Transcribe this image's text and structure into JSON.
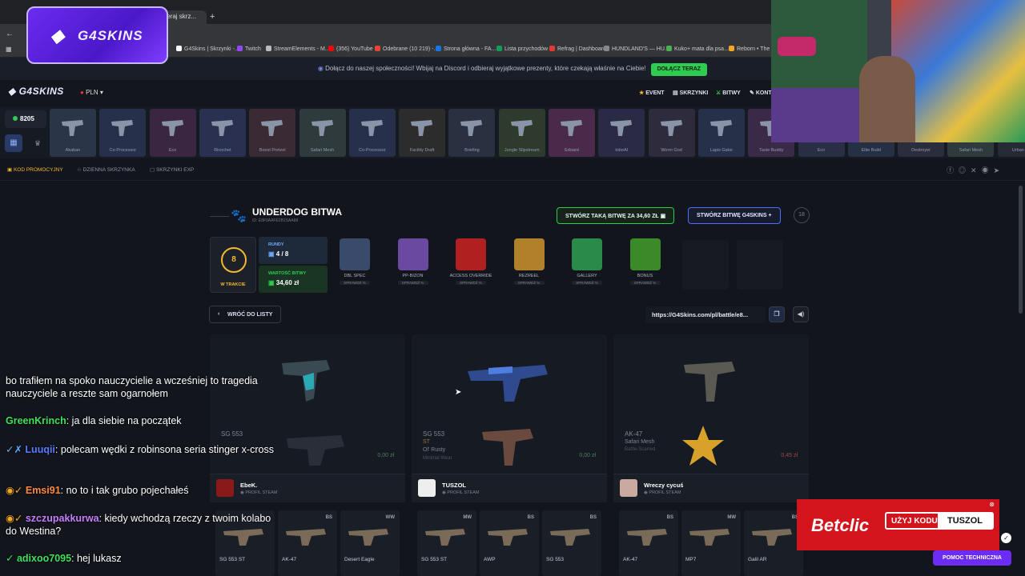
{
  "browser": {
    "active_tab": "dieraj skrz...",
    "bookmarks": [
      "G4Skins | Skrzynki -...",
      "Twitch",
      "StreamElements - M...",
      "(356) YouTube",
      "Odebrane (10 219) -...",
      "Strona główna - FA...",
      "Lista przychodów",
      "Refrag | Dashboard",
      "HUNDLAND'S — HU...",
      "Kuko+ mata dla psa...",
      "Reborn • The H"
    ]
  },
  "banner": {
    "text": "Dołącz do naszej społeczności! Wbijaj na Discord i odbieraj wyjątkowe prezenty, które czekają właśnie na Ciebie!",
    "button": "DOŁĄCZ TERAZ"
  },
  "header": {
    "logo": "G4SKINS",
    "currency": "PLN",
    "nav": [
      "EVENT",
      "SKRZYNKI",
      "BITWY",
      "KONT"
    ]
  },
  "strip": {
    "balance": "8205",
    "cases": [
      "Akaban",
      "Co-Processor",
      "Eco",
      "Ricochet",
      "Boost Pretzel",
      "Safari Mesh",
      "Co-Processor",
      "Facility Draft",
      "Briefing",
      "Jungle Slipstream",
      "Edoard",
      "tobeAI",
      "Worm God",
      "Lapis Gator",
      "Taste Buddy",
      "Eco",
      "Elite Build",
      "Destroyer",
      "Safari Mesh",
      "Urban Di"
    ]
  },
  "subnav": [
    "KOD PROMOCYJNY",
    "DZIENNA SKRZYNKA",
    "SKRZYNKI EXP"
  ],
  "battle": {
    "title": "UNDERDOG BITWA",
    "id": "ID: E8F0AAFE2B1SAA88",
    "create_same": "STWÓRZ TAKĄ BITWĘ ZA 34,60 ZŁ",
    "create_g4": "STWÓRZ BITWĘ G4SKINS",
    "age": "18",
    "status_count": "8",
    "status": "W TRAKCIE",
    "rounds_label": "RUNDY",
    "rounds": "4 / 8",
    "value_label": "WARTOŚĆ BITWY",
    "value": "34,60 zł",
    "cases": [
      {
        "name": "DBL SPEC",
        "price": "1,60 zł",
        "tag": "SPRAWDŹ %"
      },
      {
        "name": "PP-BIZON",
        "price": "4,00 zł",
        "tag": "SPRAWDŹ %"
      },
      {
        "name": "ACCESS OVERRIDE",
        "price": "4,00 zł",
        "tag": "SPRAWDŹ %"
      },
      {
        "name": "REZREEL",
        "price": "10,00 zł",
        "tag": "SPRAWDŹ %"
      },
      {
        "name": "GALLERY",
        "price": "5,00 zł",
        "tag": "SPRAWDŹ %"
      },
      {
        "name": "BONUS",
        "price": "",
        "tag": "SPRAWDŹ %"
      }
    ],
    "back": "WRÓĆ DO LISTY",
    "url": "https://G4Skins.com/pl/battle/e8..."
  },
  "players": [
    {
      "w1": "SG 553",
      "w2": "",
      "w3": "",
      "price": "0,00 zł",
      "name": "EbeK.",
      "profile": "PROFIL STEAM"
    },
    {
      "w1": "SG 553",
      "w2": "ST",
      "w3": "Ol' Rusty",
      "w4": "Minimal Wear",
      "price": "0,00 zł",
      "name": "TUSZOL",
      "profile": "PROFIL STEAM"
    },
    {
      "w1": "AK-47",
      "w2": "Safari Mesh",
      "w3": "Battle-Scarred",
      "price": "0,45 zł",
      "name": "Wreczy cycuś",
      "profile": "PROFIL STEAM"
    }
  ],
  "minis": [
    {
      "name": "SG 553 ST",
      "q": ""
    },
    {
      "name": "AK-47",
      "q": "BS"
    },
    {
      "name": "Desert Eagle",
      "q": "WW"
    },
    {
      "name": "SG 553 ST",
      "q": "MW"
    },
    {
      "name": "AWP",
      "q": "BS"
    },
    {
      "name": "SG 553",
      "q": "BS"
    },
    {
      "name": "AK-47",
      "q": "BS"
    },
    {
      "name": "MP7",
      "q": "MW"
    },
    {
      "name": "Galil AR",
      "q": "BS"
    }
  ],
  "chat": [
    {
      "user": "",
      "text": "bo trafiłem na spoko nauczycielie a wcześniej to tragedia nauczyciele a reszte sam ogarnołem"
    },
    {
      "user": "GreenKrinch",
      "text": ": ja dla siebie na początek"
    },
    {
      "user": "Luuqii",
      "text": ": polecam wędki z robinsona seria stinger x-cross"
    },
    {
      "user": "Emsi91",
      "text": ": no to i tak grubo pojechałeś"
    },
    {
      "user": "szczupakkurwa",
      "text": ": kiedy wchodzą rzeczy z twoim kolabo do Westina?"
    },
    {
      "user": "adixoo7095",
      "text": ": hej lukasz"
    }
  ],
  "overlay": {
    "logo": "G4SKINS",
    "betclic": "Betclic",
    "code_label": "UŻYJ KODU",
    "code": "TUSZOL",
    "help": "POMOC TECHNICZNA"
  },
  "colors": {
    "green": "#2ecc4f",
    "purple": "#6b2cf5",
    "red": "#d3141d"
  }
}
